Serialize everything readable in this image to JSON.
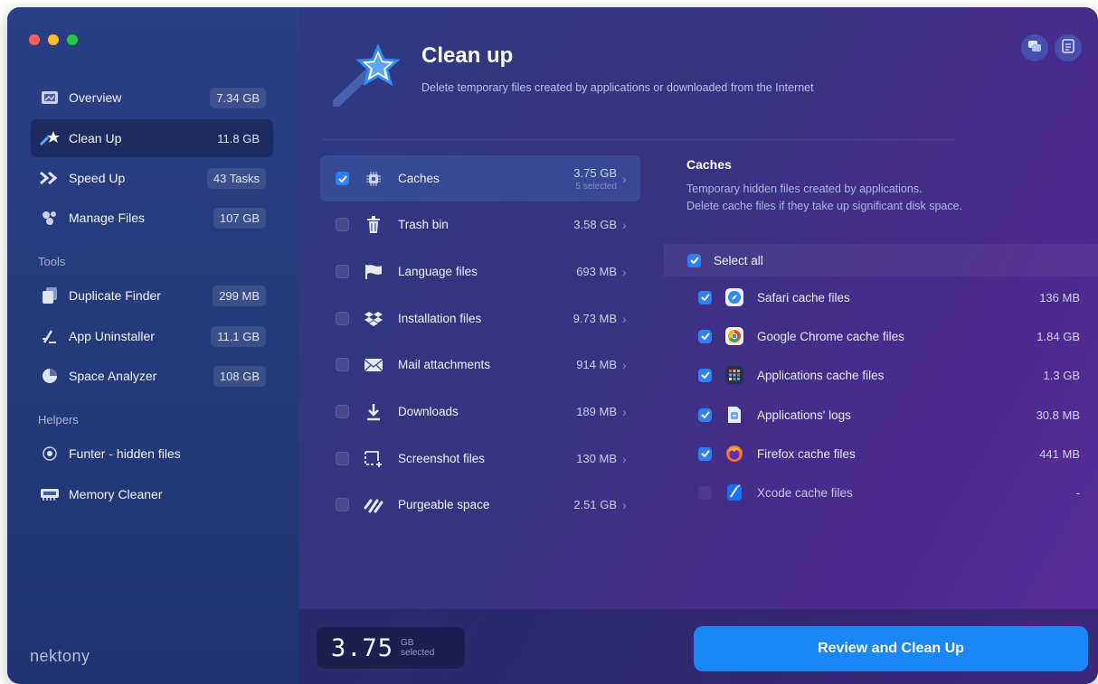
{
  "window": {
    "brand": "nektony"
  },
  "sidebar": {
    "items": [
      {
        "label": "Overview",
        "badge": "7.34 GB",
        "icon": "overview-icon"
      },
      {
        "label": "Clean Up",
        "badge": "11.8 GB",
        "icon": "cleanup-star-icon"
      },
      {
        "label": "Speed Up",
        "badge": "43 Tasks",
        "icon": "speed-chevrons-icon"
      },
      {
        "label": "Manage Files",
        "badge": "107 GB",
        "icon": "manage-files-icon"
      }
    ],
    "tools_label": "Tools",
    "tools": [
      {
        "label": "Duplicate Finder",
        "badge": "299 MB",
        "icon": "duplicate-icon"
      },
      {
        "label": "App Uninstaller",
        "badge": "11.1 GB",
        "icon": "uninstaller-icon"
      },
      {
        "label": "Space Analyzer",
        "badge": "108 GB",
        "icon": "pie-chart-icon"
      }
    ],
    "helpers_label": "Helpers",
    "helpers": [
      {
        "label": "Funter - hidden files",
        "icon": "eye-icon"
      },
      {
        "label": "Memory Cleaner",
        "icon": "memory-icon"
      }
    ]
  },
  "header": {
    "title": "Clean up",
    "subtitle": "Delete temporary files created by applications or downloaded from the Internet"
  },
  "categories": [
    {
      "label": "Caches",
      "size": "3.75 GB",
      "sub": "5 selected",
      "checked": true,
      "icon": "chip-icon"
    },
    {
      "label": "Trash bin",
      "size": "3.58 GB",
      "checked": false,
      "icon": "trash-icon"
    },
    {
      "label": "Language files",
      "size": "693 MB",
      "checked": false,
      "icon": "flag-icon"
    },
    {
      "label": "Installation files",
      "size": "9.73 MB",
      "checked": false,
      "icon": "dropbox-icon"
    },
    {
      "label": "Mail attachments",
      "size": "914 MB",
      "checked": false,
      "icon": "mail-icon"
    },
    {
      "label": "Downloads",
      "size": "189 MB",
      "checked": false,
      "icon": "download-icon"
    },
    {
      "label": "Screenshot files",
      "size": "130 MB",
      "checked": false,
      "icon": "screenshot-icon"
    },
    {
      "label": "Purgeable space",
      "size": "2.51 GB",
      "checked": false,
      "icon": "purgeable-icon"
    }
  ],
  "detail": {
    "title": "Caches",
    "desc_line1": "Temporary hidden files created by applications.",
    "desc_line2": "Delete cache files if they take up significant disk space.",
    "select_all": "Select all",
    "files": [
      {
        "label": "Safari cache files",
        "size": "136 MB",
        "checked": true,
        "icon": "safari-icon"
      },
      {
        "label": "Google Chrome cache files",
        "size": "1.84 GB",
        "checked": true,
        "icon": "chrome-icon"
      },
      {
        "label": "Applications cache files",
        "size": "1.3 GB",
        "checked": true,
        "icon": "app-grid-icon"
      },
      {
        "label": "Applications' logs",
        "size": "30.8 MB",
        "checked": true,
        "icon": "log-file-icon"
      },
      {
        "label": "Firefox cache files",
        "size": "441 MB",
        "checked": true,
        "icon": "firefox-icon"
      },
      {
        "label": "Xcode cache files",
        "size": "-",
        "checked": false,
        "icon": "xcode-icon"
      }
    ]
  },
  "footer": {
    "selected_value": "3.75",
    "selected_unit": "GB",
    "selected_caption": "selected",
    "review_button": "Review and Clean Up"
  }
}
